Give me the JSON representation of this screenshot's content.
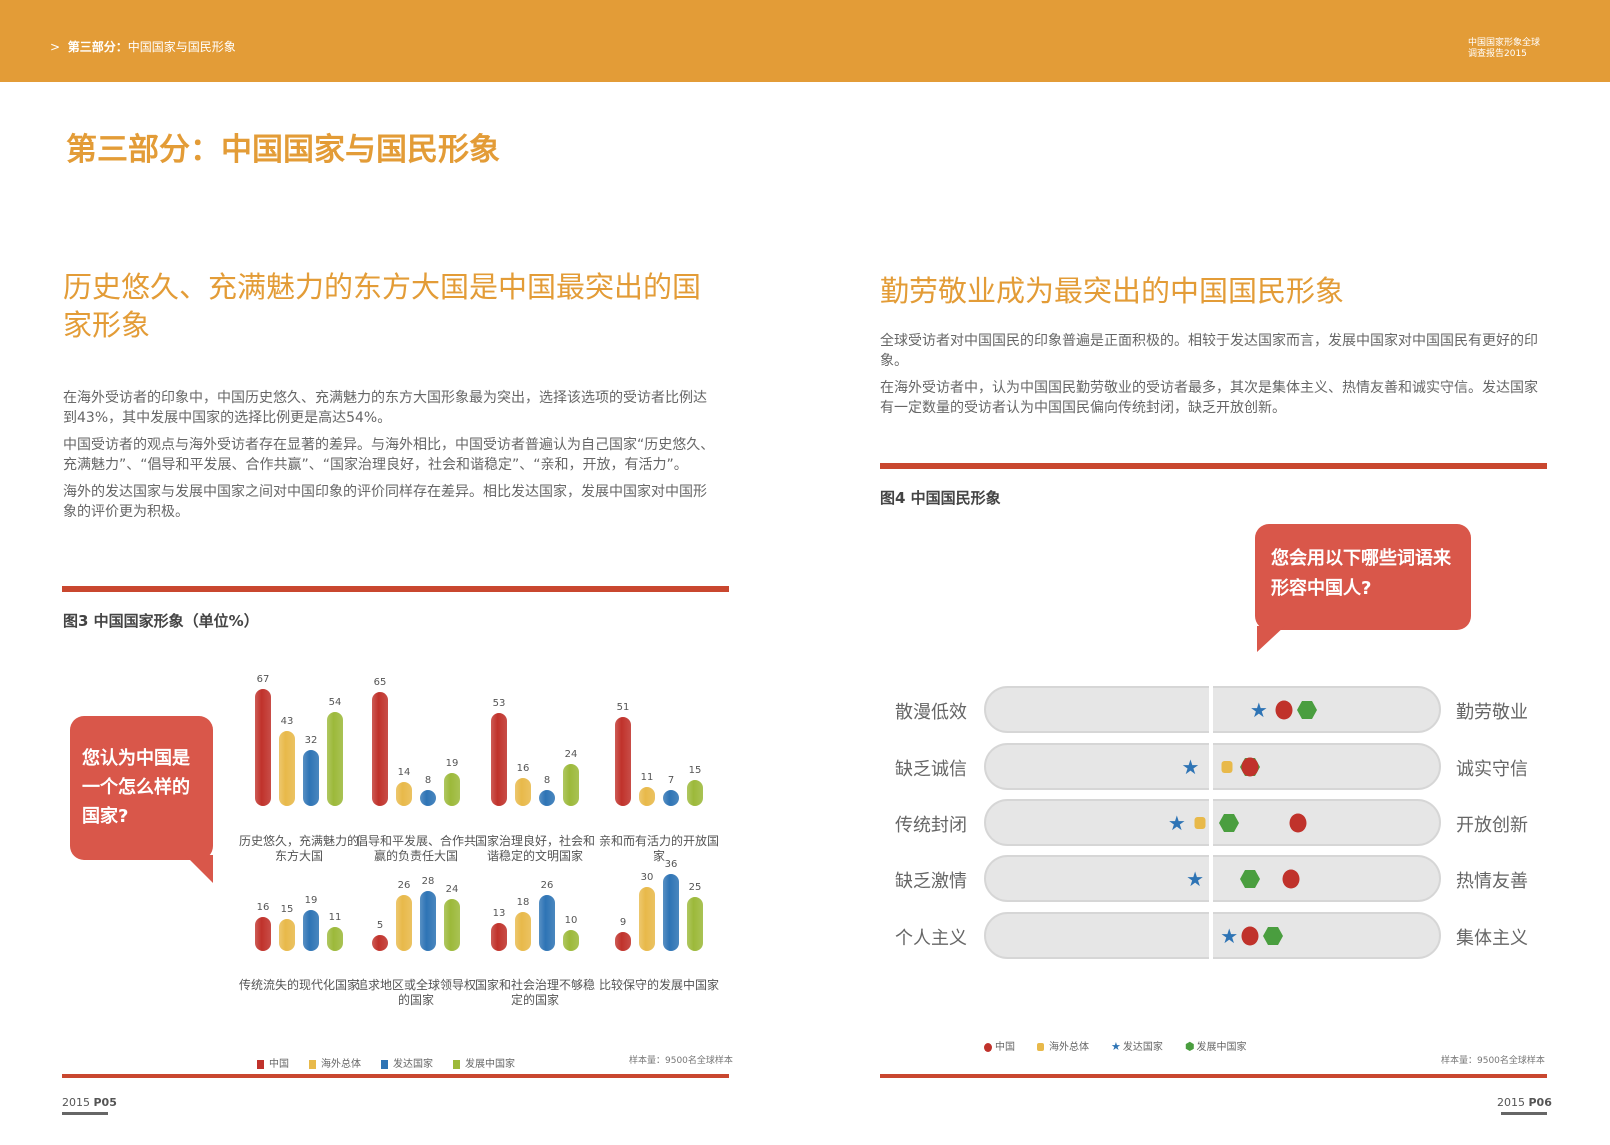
{
  "header": {
    "breadcrumb_arrow": ">",
    "breadcrumb_bold": "第三部分：",
    "breadcrumb_text": "中国国家与国民形象",
    "report_line1": "中国国家形象全球",
    "report_line2": "调查报告2015"
  },
  "page_title": "第三部分：中国国家与国民形象",
  "left": {
    "heading": "历史悠久、充满魅力的东方大国是中国最突出的国家形象",
    "paragraphs": [
      "在海外受访者的印象中，中国历史悠久、充满魅力的东方大国形象最为突出，选择该选项的受访者比例达到43%，其中发展中国家的选择比例更是高达54%。",
      "中国受访者的观点与海外受访者存在显著的差异。与海外相比，中国受访者普遍认为自己国家“历史悠久、充满魅力”、“倡导和平发展、合作共赢”、“国家治理良好，社会和谐稳定”、“亲和，开放，有活力”。",
      "海外的发达国家与发展中国家之间对中国印象的评价同样存在差异。相比发达国家，发展中国家对中国形象的评价更为积极。"
    ],
    "bubble": "您认为中国是一个怎么样的国家?",
    "sample_note": "样本量：9500名全球样本",
    "footer_year": "2015",
    "footer_page": "P05"
  },
  "right": {
    "heading": "勤劳敬业成为最突出的中国国民形象",
    "paragraphs": [
      "全球受访者对中国国民的印象普遍是正面积极的。相较于发达国家而言，发展中国家对中国国民有更好的印象。",
      "在海外受访者中，认为中国国民勤劳敬业的受访者最多，其次是集体主义、热情友善和诚实守信。发达国家有一定数量的受访者认为中国国民偏向传统封闭，缺乏开放创新。"
    ],
    "bubble": "您会用以下哪些词语来形容中国人?",
    "sample_note": "样本量：9500名全球样本",
    "footer_year": "2015",
    "footer_page": "P06"
  },
  "chart_data": [
    {
      "type": "bar",
      "title": "图3 中国国家形象（单位%）",
      "series": [
        {
          "name": "中国",
          "color": "#c0322b"
        },
        {
          "name": "海外总体",
          "color": "#e8b94a"
        },
        {
          "name": "发达国家",
          "color": "#2e74b5"
        },
        {
          "name": "发展中国家",
          "color": "#9cb93a"
        }
      ],
      "categories": [
        {
          "label": "历史悠久，充满魅力的东方大国",
          "values": [
            67,
            43,
            32,
            54
          ]
        },
        {
          "label": "倡导和平发展、合作共赢的负责任大国",
          "values": [
            65,
            14,
            8,
            19
          ]
        },
        {
          "label": "国家治理良好，社会和谐稳定的文明国家",
          "values": [
            53,
            16,
            8,
            24
          ]
        },
        {
          "label": "亲和而有活力的开放国家",
          "values": [
            51,
            11,
            7,
            15
          ]
        },
        {
          "label": "传统流失的现代化国家",
          "values": [
            16,
            15,
            19,
            11
          ]
        },
        {
          "label": "追求地区或全球领导权的国家",
          "values": [
            5,
            26,
            28,
            24
          ]
        },
        {
          "label": "国家和社会治理不够稳定的国家",
          "values": [
            13,
            18,
            26,
            10
          ]
        },
        {
          "label": "比较保守的发展中国家",
          "values": [
            9,
            30,
            36,
            25
          ]
        }
      ]
    },
    {
      "type": "scatter",
      "title": "图4 中国国民形象",
      "x_range": [
        -1,
        1
      ],
      "series": [
        {
          "name": "中国",
          "color": "#c0322b",
          "marker": "circle"
        },
        {
          "name": "海外总体",
          "color": "#e8b94a",
          "marker": "square"
        },
        {
          "name": "发达国家",
          "color": "#2e74b5",
          "marker": "star"
        },
        {
          "name": "发展中国家",
          "color": "#4a9e3f",
          "marker": "hexagon"
        }
      ],
      "rows": [
        {
          "left": "散漫低效",
          "right": "勤劳敬业",
          "values": [
            0.32,
            0.32,
            0.21,
            0.42
          ]
        },
        {
          "left": "缺乏诚信",
          "right": "诚实守信",
          "values": [
            0.17,
            0.07,
            -0.09,
            0.17
          ]
        },
        {
          "left": "传统封闭",
          "right": "开放创新",
          "values": [
            0.38,
            -0.05,
            -0.15,
            0.08
          ]
        },
        {
          "left": "缺乏激情",
          "right": "热情友善",
          "values": [
            0.35,
            null,
            -0.07,
            0.17
          ]
        },
        {
          "left": "个人主义",
          "right": "集体主义",
          "values": [
            0.17,
            0.17,
            0.08,
            0.27
          ]
        }
      ]
    }
  ]
}
